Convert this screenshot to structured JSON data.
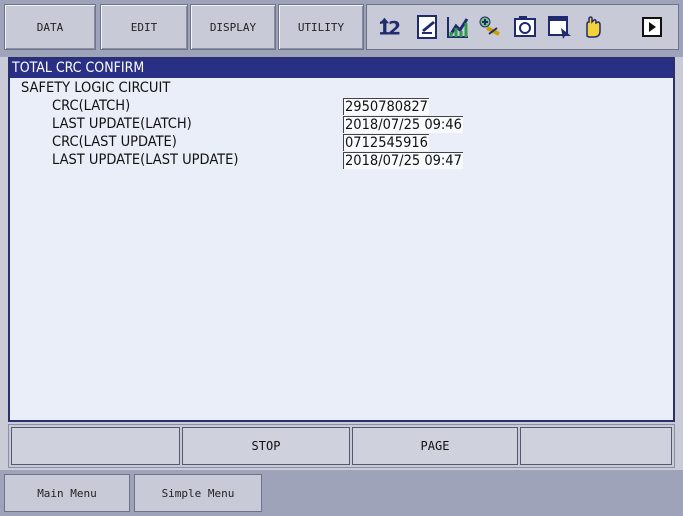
{
  "top_menu": {
    "data": "DATA",
    "edit": "EDIT",
    "display": "DISPLAY",
    "utility": "UTILITY"
  },
  "status_icons": [
    "sort-numbers-icon",
    "edit-document-icon",
    "chart-icon",
    "plus-network-icon",
    "camera-icon",
    "window-arrow-icon",
    "hand-icon",
    "play-right-icon"
  ],
  "screen": {
    "title": "TOTAL CRC CONFIRM",
    "section": "SAFETY LOGIC CIRCUIT",
    "rows": [
      {
        "label": "CRC(LATCH)",
        "value": "2950780827"
      },
      {
        "label": "LAST UPDATE(LATCH)",
        "value": "2018/07/25 09:46"
      },
      {
        "label": "CRC(LAST UPDATE)",
        "value": "0712545916"
      },
      {
        "label": "LAST UPDATE(LAST UPDATE)",
        "value": "2018/07/25 09:47"
      }
    ]
  },
  "function_keys": {
    "f1": "",
    "f2": "STOP",
    "f3": "PAGE",
    "f4": ""
  },
  "footer": {
    "main_menu": "Main Menu",
    "simple_menu": "Simple Menu"
  },
  "colors": {
    "title_bar": "#2a2f86",
    "screen_bg": "#eaeef8",
    "frame": "#9fa3ba"
  }
}
